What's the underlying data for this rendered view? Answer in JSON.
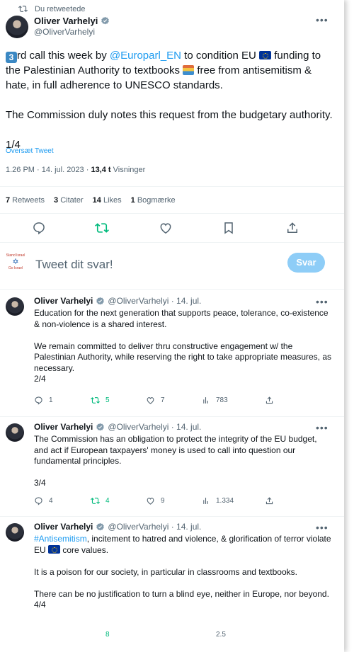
{
  "retweet_header": "Du retweetede",
  "main_tweet": {
    "name": "Oliver Varhelyi",
    "handle": "@OliverVarhelyi",
    "text_parts": {
      "p1": "rd call this week by ",
      "mention": "@Europarl_EN",
      "p2": " to condition EU ",
      "p3": " funding to the Palestinian Authority to textbooks ",
      "p4": " free from antisemitism & hate, in full adherence to UNESCO standards.",
      "para2": "The Commission duly notes this request from the budgetary authority.",
      "counter": "1/4",
      "keycap": "3"
    },
    "translate": "Oversæt Tweet",
    "timestamp": "1.26 PM · 14. jul. 2023 · ",
    "views_count": "13,4 t",
    "views_label": " Visninger",
    "stats": {
      "retweets_n": "7",
      "retweets_l": " Retweets",
      "quotes_n": "3",
      "quotes_l": " Citater",
      "likes_n": "14",
      "likes_l": " Likes",
      "bookmarks_n": "1",
      "bookmarks_l": " Bogmærke"
    }
  },
  "reply": {
    "placeholder": "Tweet dit svar!",
    "button": "Svar",
    "logo_top": "Stand Israel",
    "logo_bottom": "Go Israel"
  },
  "replies": [
    {
      "name": "Oliver Varhelyi",
      "handle": "@OliverVarhelyi · 14. jul.",
      "text": "Education for the next generation that supports peace, tolerance, co-existence & non-violence is a shared interest.\n\nWe remain committed to deliver thru constructive engagement w/ the Palestinian Authority, while reserving the right to take appropriate measures, as necessary.\n2/4",
      "replies": "1",
      "retweets": "5",
      "likes": "7",
      "views": "783"
    },
    {
      "name": "Oliver Varhelyi",
      "handle": "@OliverVarhelyi · 14. jul.",
      "text": "The Commission has an obligation to protect the integrity of the EU budget, and act if European taxpayers' money is used to call into question our fundamental principles.\n\n3/4",
      "replies": "4",
      "retweets": "4",
      "likes": "9",
      "views": "1.334"
    },
    {
      "name": "Oliver Varhelyi",
      "handle": "@OliverVarhelyi · 14. jul.",
      "hashtag": "#Antisemitism",
      "text_a": ", incitement to hatred and violence, & glorification of terror violate EU ",
      "text_b": " core values.\n\nIt is a poison for our society, in particular in classrooms and textbooks.\n\nThere can be no justification to turn a blind eye, neither in Europe, nor beyond.\n4/4",
      "retweets": "8",
      "views": "2.5"
    }
  ],
  "colors": {
    "accent": "#1d9bf0",
    "retweet_green": "#00ba7c",
    "muted": "#536471"
  }
}
